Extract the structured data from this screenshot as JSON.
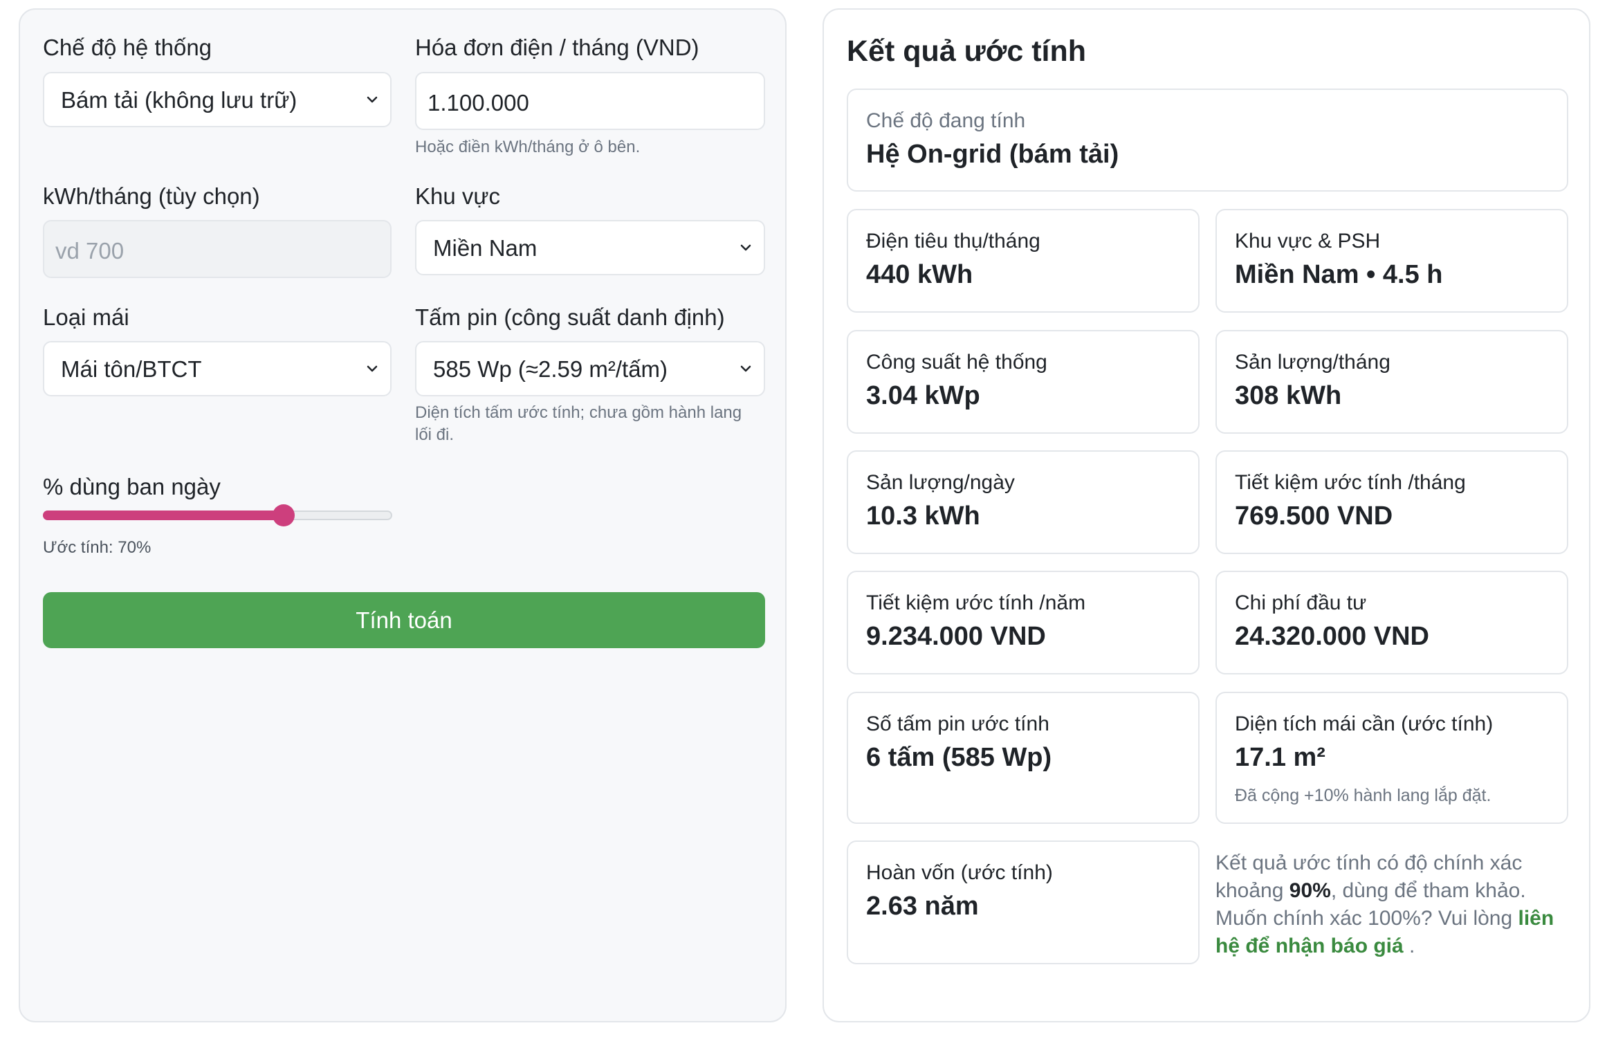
{
  "form": {
    "system_mode": {
      "label": "Chế độ hệ thống",
      "value": "Bám tải (không lưu trữ)"
    },
    "bill": {
      "label": "Hóa đơn điện / tháng (VND)",
      "value": "1.100.000",
      "hint": "Hoặc điền kWh/tháng ở ô bên."
    },
    "kwh": {
      "label": "kWh/tháng (tùy chọn)",
      "placeholder": "vd 700"
    },
    "region": {
      "label": "Khu vực",
      "value": "Miền Nam"
    },
    "roof": {
      "label": "Loại mái",
      "value": "Mái tôn/BTCT"
    },
    "panel": {
      "label": "Tấm pin (công suất danh định)",
      "value": "585 Wp (≈2.59 m²/tấm)",
      "hint_line1": "Diện tích tấm ước tính; chưa gồm hành lang",
      "hint_line2": "lối đi."
    },
    "daytime": {
      "label": "% dùng ban ngày",
      "estimate_text": "Ước tính: 70%",
      "percent": 70
    },
    "calculate_label": "Tính toán"
  },
  "results": {
    "title": "Kết quả ước tính",
    "mode": {
      "label": "Chế độ đang tính",
      "value": "Hệ On-grid (bám tải)"
    },
    "consumption": {
      "label": "Điện tiêu thụ/tháng",
      "value": "440 kWh"
    },
    "region_psh": {
      "label": "Khu vực & PSH",
      "value": "Miền Nam • 4.5 h"
    },
    "capacity": {
      "label": "Công suất hệ thống",
      "value": "3.04 kWp"
    },
    "output_month": {
      "label": "Sản lượng/tháng",
      "value": "308 kWh"
    },
    "output_day": {
      "label": "Sản lượng/ngày",
      "value": "10.3 kWh"
    },
    "savings_month": {
      "label": "Tiết kiệm ước tính /tháng",
      "value": "769.500 VND"
    },
    "savings_year": {
      "label": "Tiết kiệm ước tính /năm",
      "value": "9.234.000 VND"
    },
    "investment": {
      "label": "Chi phí đầu tư",
      "value": "24.320.000 VND"
    },
    "panel_count": {
      "label": "Số tấm pin ước tính",
      "value": "6 tấm (585 Wp)"
    },
    "roof_area": {
      "label": "Diện tích mái cần (ước tính)",
      "value": "17.1 m²",
      "note": "Đã cộng +10% hành lang lắp đặt."
    },
    "payback": {
      "label": "Hoàn vốn (ước tính)",
      "value": "2.63 năm"
    },
    "disclaimer": {
      "text1": "Kết quả ước tính có độ chính xác khoảng ",
      "accuracy": "90%",
      "text2": ", dùng để tham khảo. Muốn chính xác 100%? Vui lòng ",
      "link": "liên hệ để nhận báo giá",
      "text3": " ."
    }
  },
  "colors": {
    "accent_pink": "#cd3f7d",
    "button_green": "#4ea454",
    "link_green": "#3a8a3f"
  }
}
